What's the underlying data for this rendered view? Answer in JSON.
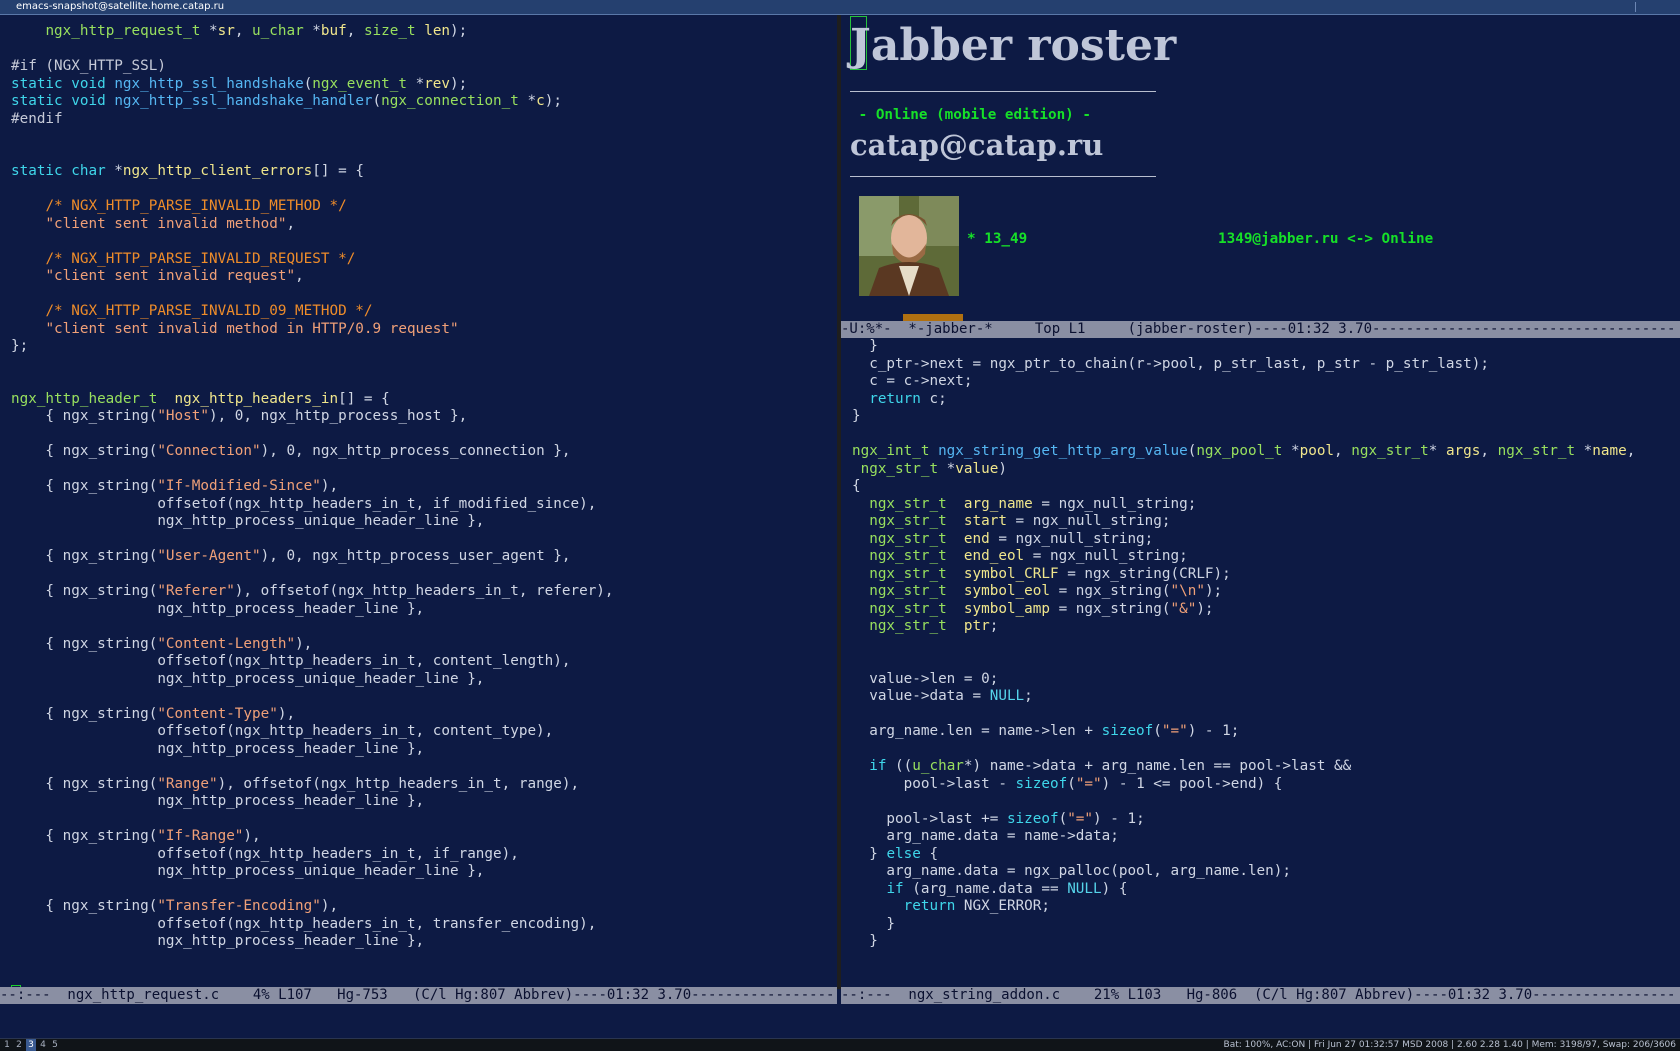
{
  "window": {
    "title": "emacs-snapshot@satellite.home.catap.ru"
  },
  "colors": {
    "background": "#0d1a44",
    "default": "#d0d6e4",
    "type": "#98e05e",
    "keyword": "#3fd6ea",
    "comment": "#ee8c2a",
    "string": "#f0a078",
    "preproc": "#c6cad8",
    "function": "#55b6f2",
    "var": "#f0e68c",
    "constant": "#56d4ea"
  },
  "left_pane": {
    "lines": [
      [
        [
          "    ",
          "d"
        ],
        [
          "ngx_http_request_t",
          "t"
        ],
        [
          " *",
          "d"
        ],
        [
          "sr",
          "v"
        ],
        [
          ", ",
          "d"
        ],
        [
          "u_char",
          "t"
        ],
        [
          " *",
          "d"
        ],
        [
          "buf",
          "v"
        ],
        [
          ", ",
          "d"
        ],
        [
          "size_t",
          "t"
        ],
        [
          " ",
          "d"
        ],
        [
          "len",
          "v"
        ],
        [
          ");",
          "d"
        ]
      ],
      [],
      [
        [
          "#if (NGX_HTTP_SSL)",
          "p"
        ]
      ],
      [
        [
          "static",
          "k"
        ],
        [
          " ",
          "d"
        ],
        [
          "void",
          "k"
        ],
        [
          " ",
          "d"
        ],
        [
          "ngx_http_ssl_handshake",
          "f"
        ],
        [
          "(",
          "d"
        ],
        [
          "ngx_event_t",
          "t"
        ],
        [
          " *",
          "d"
        ],
        [
          "rev",
          "v"
        ],
        [
          ");",
          "d"
        ]
      ],
      [
        [
          "static",
          "k"
        ],
        [
          " ",
          "d"
        ],
        [
          "void",
          "k"
        ],
        [
          " ",
          "d"
        ],
        [
          "ngx_http_ssl_handshake_handler",
          "f"
        ],
        [
          "(",
          "d"
        ],
        [
          "ngx_connection_t",
          "t"
        ],
        [
          " *",
          "d"
        ],
        [
          "c",
          "v"
        ],
        [
          ");",
          "d"
        ]
      ],
      [
        [
          "#endif",
          "p"
        ]
      ],
      [],
      [],
      [
        [
          "static",
          "k"
        ],
        [
          " ",
          "d"
        ],
        [
          "char",
          "k"
        ],
        [
          " *",
          "d"
        ],
        [
          "ngx_http_client_errors",
          "v"
        ],
        [
          "[] = {",
          "d"
        ]
      ],
      [],
      [
        [
          "    ",
          "d"
        ],
        [
          "/* NGX_HTTP_PARSE_INVALID_METHOD */",
          "c"
        ]
      ],
      [
        [
          "    ",
          "d"
        ],
        [
          "\"client sent invalid method\"",
          "s"
        ],
        [
          ",",
          "d"
        ]
      ],
      [],
      [
        [
          "    ",
          "d"
        ],
        [
          "/* NGX_HTTP_PARSE_INVALID_REQUEST */",
          "c"
        ]
      ],
      [
        [
          "    ",
          "d"
        ],
        [
          "\"client sent invalid request\"",
          "s"
        ],
        [
          ",",
          "d"
        ]
      ],
      [],
      [
        [
          "    ",
          "d"
        ],
        [
          "/* NGX_HTTP_PARSE_INVALID_09_METHOD */",
          "c"
        ]
      ],
      [
        [
          "    ",
          "d"
        ],
        [
          "\"client sent invalid method in HTTP/0.9 request\"",
          "s"
        ]
      ],
      [
        [
          "};",
          "d"
        ]
      ],
      [],
      [],
      [
        [
          "ngx_http_header_t",
          "t"
        ],
        [
          "  ",
          "d"
        ],
        [
          "ngx_http_headers_in",
          "v"
        ],
        [
          "[] = {",
          "d"
        ]
      ],
      [
        [
          "    { ngx_string(",
          "d"
        ],
        [
          "\"Host\"",
          "s"
        ],
        [
          "), 0, ngx_http_process_host },",
          "d"
        ]
      ],
      [],
      [
        [
          "    { ngx_string(",
          "d"
        ],
        [
          "\"Connection\"",
          "s"
        ],
        [
          "), 0, ngx_http_process_connection },",
          "d"
        ]
      ],
      [],
      [
        [
          "    { ngx_string(",
          "d"
        ],
        [
          "\"If-Modified-Since\"",
          "s"
        ],
        [
          "),",
          "d"
        ]
      ],
      [
        [
          "                 offsetof(ngx_http_headers_in_t, if_modified_since),",
          "d"
        ]
      ],
      [
        [
          "                 ngx_http_process_unique_header_line },",
          "d"
        ]
      ],
      [],
      [
        [
          "    { ngx_string(",
          "d"
        ],
        [
          "\"User-Agent\"",
          "s"
        ],
        [
          "), 0, ngx_http_process_user_agent },",
          "d"
        ]
      ],
      [],
      [
        [
          "    { ngx_string(",
          "d"
        ],
        [
          "\"Referer\"",
          "s"
        ],
        [
          "), offsetof(ngx_http_headers_in_t, referer),",
          "d"
        ]
      ],
      [
        [
          "                 ngx_http_process_header_line },",
          "d"
        ]
      ],
      [],
      [
        [
          "    { ngx_string(",
          "d"
        ],
        [
          "\"Content-Length\"",
          "s"
        ],
        [
          "),",
          "d"
        ]
      ],
      [
        [
          "                 offsetof(ngx_http_headers_in_t, content_length),",
          "d"
        ]
      ],
      [
        [
          "                 ngx_http_process_unique_header_line },",
          "d"
        ]
      ],
      [],
      [
        [
          "    { ngx_string(",
          "d"
        ],
        [
          "\"Content-Type\"",
          "s"
        ],
        [
          "),",
          "d"
        ]
      ],
      [
        [
          "                 offsetof(ngx_http_headers_in_t, content_type),",
          "d"
        ]
      ],
      [
        [
          "                 ngx_http_process_header_line },",
          "d"
        ]
      ],
      [],
      [
        [
          "    { ngx_string(",
          "d"
        ],
        [
          "\"Range\"",
          "s"
        ],
        [
          "), offsetof(ngx_http_headers_in_t, range),",
          "d"
        ]
      ],
      [
        [
          "                 ngx_http_process_header_line },",
          "d"
        ]
      ],
      [],
      [
        [
          "    { ngx_string(",
          "d"
        ],
        [
          "\"If-Range\"",
          "s"
        ],
        [
          "),",
          "d"
        ]
      ],
      [
        [
          "                 offsetof(ngx_http_headers_in_t, if_range),",
          "d"
        ]
      ],
      [
        [
          "                 ngx_http_process_unique_header_line },",
          "d"
        ]
      ],
      [],
      [
        [
          "    { ngx_string(",
          "d"
        ],
        [
          "\"Transfer-Encoding\"",
          "s"
        ],
        [
          "),",
          "d"
        ]
      ],
      [
        [
          "                 offsetof(ngx_http_headers_in_t, transfer_encoding),",
          "d"
        ]
      ],
      [
        [
          "                 ngx_http_process_header_line },",
          "d"
        ]
      ]
    ],
    "modeline": "--:---  ngx_http_request.c    4% L107   Hg-753   (C/l Hg:807 Abbrev)----01:32 3.70-----------------"
  },
  "jabber": {
    "title": "Jabber roster",
    "status": " - Online (mobile edition) -",
    "account": "catap@catap.ru",
    "contact_name": "* 13_49",
    "contact_jid": "1349@jabber.ru <-> Online",
    "modeline": "-U:%*-  *-jabber-*     Top L1     (jabber-roster)----01:32 3.70------------------------------------"
  },
  "right_pane": {
    "lines": [
      [
        [
          "  }",
          "d"
        ]
      ],
      [
        [
          "  c_ptr->next = ngx_ptr_to_chain(r->pool, p_str_last, p_str - p_str_last);",
          "d"
        ]
      ],
      [
        [
          "  c = c->next;",
          "d"
        ]
      ],
      [
        [
          "  ",
          "d"
        ],
        [
          "return",
          "k"
        ],
        [
          " c;",
          "d"
        ]
      ],
      [
        [
          "}",
          "d"
        ]
      ],
      [],
      [
        [
          "ngx_int_t",
          "t"
        ],
        [
          " ",
          "d"
        ],
        [
          "ngx_string_get_http_arg_value",
          "f"
        ],
        [
          "(",
          "d"
        ],
        [
          "ngx_pool_t",
          "t"
        ],
        [
          " *",
          "d"
        ],
        [
          "pool",
          "v"
        ],
        [
          ", ",
          "d"
        ],
        [
          "ngx_str_t",
          "t"
        ],
        [
          "* ",
          "d"
        ],
        [
          "args",
          "v"
        ],
        [
          ", ",
          "d"
        ],
        [
          "ngx_str_t",
          "t"
        ],
        [
          " *",
          "d"
        ],
        [
          "name",
          "v"
        ],
        [
          ",",
          "d"
        ]
      ],
      [
        [
          " ",
          "d"
        ],
        [
          "ngx_str_t",
          "t"
        ],
        [
          " *",
          "d"
        ],
        [
          "value",
          "v"
        ],
        [
          ")",
          "d"
        ]
      ],
      [
        [
          "{",
          "d"
        ]
      ],
      [
        [
          "  ",
          "d"
        ],
        [
          "ngx_str_t",
          "t"
        ],
        [
          "  ",
          "d"
        ],
        [
          "arg_name",
          "v"
        ],
        [
          " = ngx_null_string;",
          "d"
        ]
      ],
      [
        [
          "  ",
          "d"
        ],
        [
          "ngx_str_t",
          "t"
        ],
        [
          "  ",
          "d"
        ],
        [
          "start",
          "v"
        ],
        [
          " = ngx_null_string;",
          "d"
        ]
      ],
      [
        [
          "  ",
          "d"
        ],
        [
          "ngx_str_t",
          "t"
        ],
        [
          "  ",
          "d"
        ],
        [
          "end",
          "v"
        ],
        [
          " = ngx_null_string;",
          "d"
        ]
      ],
      [
        [
          "  ",
          "d"
        ],
        [
          "ngx_str_t",
          "t"
        ],
        [
          "  ",
          "d"
        ],
        [
          "end_eol",
          "v"
        ],
        [
          " = ngx_null_string;",
          "d"
        ]
      ],
      [
        [
          "  ",
          "d"
        ],
        [
          "ngx_str_t",
          "t"
        ],
        [
          "  ",
          "d"
        ],
        [
          "symbol_CRLF",
          "v"
        ],
        [
          " = ngx_string(CRLF);",
          "d"
        ]
      ],
      [
        [
          "  ",
          "d"
        ],
        [
          "ngx_str_t",
          "t"
        ],
        [
          "  ",
          "d"
        ],
        [
          "symbol_eol",
          "v"
        ],
        [
          " = ngx_string(",
          "d"
        ],
        [
          "\"\\n\"",
          "s"
        ],
        [
          ");",
          "d"
        ]
      ],
      [
        [
          "  ",
          "d"
        ],
        [
          "ngx_str_t",
          "t"
        ],
        [
          "  ",
          "d"
        ],
        [
          "symbol_amp",
          "v"
        ],
        [
          " = ngx_string(",
          "d"
        ],
        [
          "\"&\"",
          "s"
        ],
        [
          ");",
          "d"
        ]
      ],
      [
        [
          "  ",
          "d"
        ],
        [
          "ngx_str_t",
          "t"
        ],
        [
          "  ",
          "d"
        ],
        [
          "ptr",
          "v"
        ],
        [
          ";",
          "d"
        ]
      ],
      [],
      [],
      [
        [
          "  value->len = 0;",
          "d"
        ]
      ],
      [
        [
          "  value->data = ",
          "d"
        ],
        [
          "NULL",
          "n"
        ],
        [
          ";",
          "d"
        ]
      ],
      [],
      [
        [
          "  arg_name.len = name->len + ",
          "d"
        ],
        [
          "sizeof",
          "k"
        ],
        [
          "(",
          "d"
        ],
        [
          "\"=\"",
          "s"
        ],
        [
          ") - 1;",
          "d"
        ]
      ],
      [],
      [
        [
          "  ",
          "d"
        ],
        [
          "if",
          "k"
        ],
        [
          " ((",
          "d"
        ],
        [
          "u_char",
          "t"
        ],
        [
          "*) name->data + arg_name.len == pool->last &&",
          "d"
        ]
      ],
      [
        [
          "      pool->last - ",
          "d"
        ],
        [
          "sizeof",
          "k"
        ],
        [
          "(",
          "d"
        ],
        [
          "\"=\"",
          "s"
        ],
        [
          ") - 1 <= pool->end) {",
          "d"
        ]
      ],
      [],
      [
        [
          "    pool->last += ",
          "d"
        ],
        [
          "sizeof",
          "k"
        ],
        [
          "(",
          "d"
        ],
        [
          "\"=\"",
          "s"
        ],
        [
          ") - 1;",
          "d"
        ]
      ],
      [
        [
          "    arg_name.data = name->data;",
          "d"
        ]
      ],
      [
        [
          "  } ",
          "d"
        ],
        [
          "else",
          "k"
        ],
        [
          " {",
          "d"
        ]
      ],
      [
        [
          "    arg_name.data = ngx_palloc(pool, arg_name.len);",
          "d"
        ]
      ],
      [
        [
          "    ",
          "d"
        ],
        [
          "if",
          "k"
        ],
        [
          " (arg_name.data == ",
          "d"
        ],
        [
          "NULL",
          "n"
        ],
        [
          ") {",
          "d"
        ]
      ],
      [
        [
          "      ",
          "d"
        ],
        [
          "return",
          "k"
        ],
        [
          " NGX_ERROR;",
          "d"
        ]
      ],
      [
        [
          "    }",
          "d"
        ]
      ],
      [
        [
          "  }",
          "d"
        ]
      ]
    ],
    "modeline": "--:---  ngx_string_addon.c    21% L103   Hg-806  (C/l Hg:807 Abbrev)----01:32 3.70-----------------"
  },
  "statusbar": {
    "workspaces": [
      "1",
      "2",
      "3",
      "4",
      "5"
    ],
    "active_workspace": "3",
    "system": "Bat: 100%, AC:ON | Fri Jun 27 01:32:57 MSD 2008 | 2.60 2.28 1.40 | Mem: 3198/97, Swap: 206/3606"
  }
}
